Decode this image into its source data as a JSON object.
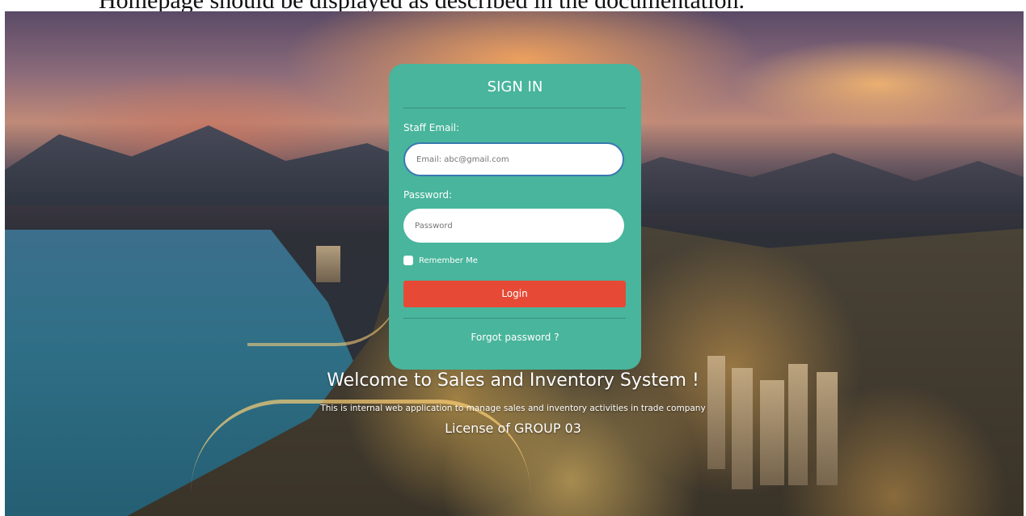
{
  "document_caption": "Homepage should be displayed as described in the documentation.",
  "background": {
    "description_icon": "city-night-landscape-image"
  },
  "signin": {
    "title": "SIGN IN",
    "email_label": "Staff Email:",
    "email_placeholder": "Email: abc@gmail.com",
    "password_label": "Password:",
    "password_placeholder": "Password",
    "remember_label": "Remember Me",
    "login_label": "Login",
    "forgot_label": "Forgot password ?"
  },
  "footer": {
    "welcome": "Welcome to Sales and Inventory System !",
    "subtitle": "This is internal web application to manage sales and inventory activities in trade company",
    "license": "License of GROUP 03"
  },
  "colors": {
    "card": "#48b59c",
    "login_button": "#e64a36",
    "input_focus_border": "#3a78b0"
  }
}
